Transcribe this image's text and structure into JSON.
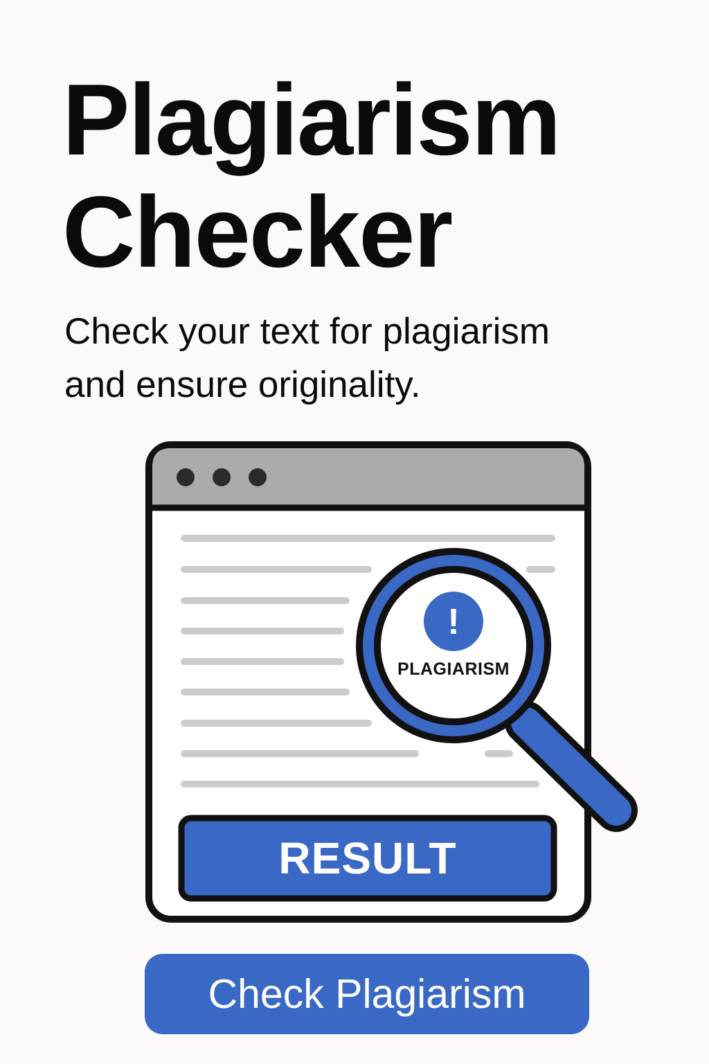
{
  "header": {
    "title_line1": "Plagiarism",
    "title_line2": "Checker",
    "subtitle_line1": "Check your text for plagiarism",
    "subtitle_line2": "and ensure originality."
  },
  "illustration": {
    "lens_label": "PLAGIARISM",
    "alert_symbol": "!",
    "result_label": "RESULT",
    "icons": [
      "browser-window-icon",
      "magnifying-glass-icon",
      "alert-icon"
    ]
  },
  "cta": {
    "label": "Check Plagiarism"
  },
  "colors": {
    "background": "#fbfaf8",
    "accent_blue": "#3a68c5",
    "outline": "#111111",
    "titlebar_gray": "#ababab",
    "text_line_gray": "#cccccc"
  }
}
